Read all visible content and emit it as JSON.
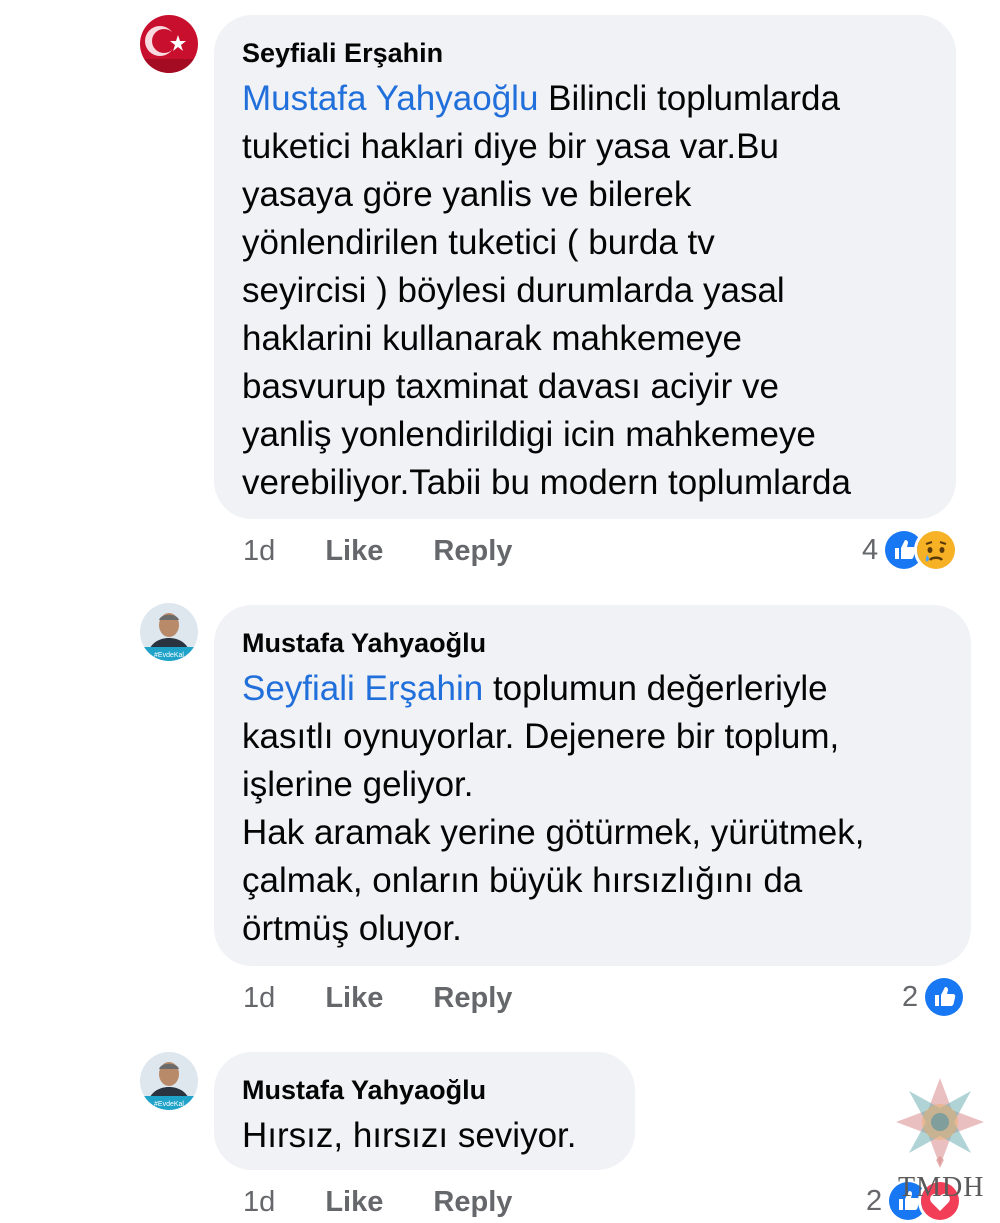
{
  "comments": [
    {
      "author": "Seyfiali Erşahin",
      "mention": "Mustafa Yahyaoğlu",
      "text": " Bilincli  toplumlarda\ntuketici haklari diye bir yasa var.Bu\nyasaya  göre yanlis ve bilerek\nyönlendirilen tuketici ( burda tv\nseyircisi ) böylesi durumlarda yasal\nhaklarini kullanarak mahkemeye\nbasvurup taxminat davası aciyir ve\nyanliş yonlendirildigi icin mahkemeye\nverebiliyor.Tabii bu modern toplumlarda",
      "time": "1d",
      "like_label": "Like",
      "reply_label": "Reply",
      "reaction_count": "4",
      "reaction_icons": [
        "like-icon",
        "sad-icon"
      ]
    },
    {
      "author": "Mustafa Yahyaoğlu",
      "mention": "Seyfiali Erşahin",
      "text": " toplumun değerleriyle\nkasıtlı oynuyorlar. Dejenere bir toplum,\nişlerine geliyor.\nHak aramak yerine götürmek, yürütmek,\nçalmak, onların büyük hırsızlığını da\nörtmüş oluyor.",
      "time": "1d",
      "like_label": "Like",
      "reply_label": "Reply",
      "reaction_count": "2",
      "reaction_icons": [
        "like-icon"
      ]
    },
    {
      "author": "Mustafa Yahyaoğlu",
      "mention": "",
      "text": "Hırsız, hırsızı seviyor.",
      "time": "1d",
      "like_label": "Like",
      "reply_label": "Reply",
      "reaction_count": "2",
      "reaction_icons": [
        "like-icon",
        "love-icon"
      ]
    }
  ],
  "avatar_badge": "#EvdeKal",
  "watermark": "TMDH",
  "colors": {
    "bubble": "#f0f2f5",
    "mention": "#216fdb",
    "meta": "#65676b",
    "like": "#1877f2",
    "love": "#f33e58",
    "sad": "#f7b125"
  }
}
